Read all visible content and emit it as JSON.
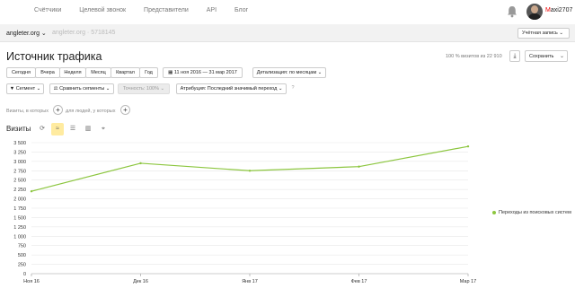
{
  "nav": {
    "links": [
      "Счётчики",
      "Целевой звонок",
      "Представители",
      "API",
      "Блог"
    ],
    "user_first": "M",
    "user_rest": "axi2707"
  },
  "sitebar": {
    "site": "angleter.org",
    "site_dim": "angleter.org  ·  5718145",
    "account_label": "Учётная запись"
  },
  "header": {
    "title": "Источник трафика",
    "visits_note": "100 % визитов из 22 910",
    "save_label": "Сохранить"
  },
  "periods": [
    "Сегодня",
    "Вчера",
    "Неделя",
    "Месяц",
    "Квартал",
    "Год"
  ],
  "date_range": "11 ноя 2016 — 31 мар 2017",
  "detail_label": "Детализация: по месяцам",
  "segment_label": "Сегмент",
  "compare_label": "Сравнить сегменты",
  "accuracy_label": "Точность: 100%",
  "attribution_label": "Атрибуция: Последний значимый переход",
  "filter": {
    "visits_text": "Визиты, в которых",
    "users_text": "для людей, у которых"
  },
  "chart_header": "Визиты",
  "colors": {
    "line": "#8cc63f",
    "active_type": "#ffeba0"
  },
  "chart_data": {
    "type": "line",
    "categories": [
      "Ноя 16",
      "Дек 16",
      "Янв 17",
      "Фев 17",
      "Мар 17"
    ],
    "x": [
      "2016-11-01",
      "2016-12-01",
      "2017-01-01",
      "2017-02-01",
      "2017-03-01"
    ],
    "series": [
      {
        "name": "Переходы из поисковых систем",
        "values": [
          2200,
          2950,
          2750,
          2860,
          3400
        ]
      }
    ],
    "yticks": [
      0,
      250,
      500,
      750,
      1000,
      1250,
      1500,
      1750,
      2000,
      2250,
      2500,
      2750,
      3000,
      3250,
      3500
    ],
    "ytick_labels": [
      "0",
      "250",
      "500",
      "750",
      "1 000",
      "1 250",
      "1 500",
      "1 750",
      "2 000",
      "2 250",
      "2 500",
      "2 750",
      "3 000",
      "3 250",
      "3 500"
    ],
    "ylim": [
      0,
      3500
    ],
    "title": "",
    "xlabel": "",
    "ylabel": "",
    "grid": true,
    "legend_placement": "right"
  }
}
